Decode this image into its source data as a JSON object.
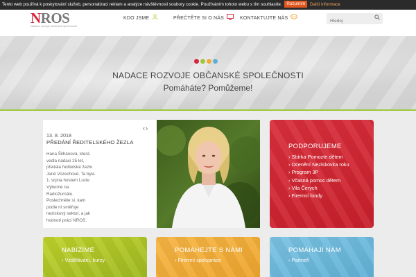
{
  "cookie_bar": {
    "text": "Tento web používá k poskytování služeb, personalizaci reklam a analýze návštěvnosti soubory cookie. Používáním tohoto webu s tím souhlasíte.",
    "accept_label": "Rozumím",
    "more_label": "Další informace"
  },
  "header": {
    "logo": {
      "text": "NROS",
      "subtitle": "Nadace rozvoje občanské společnosti"
    },
    "nav": [
      {
        "label": "KDO JSME",
        "icon": "person-icon"
      },
      {
        "label": "PŘEČTĚTE SI O NÁS",
        "icon": "screen-icon"
      },
      {
        "label": "KONTAKTUJTE NÁS",
        "icon": "chat-icon"
      }
    ],
    "search": {
      "placeholder": "Hledej"
    }
  },
  "hero": {
    "title": "NADACE ROZVOJE OBČANSKÉ SPOLEČNOSTI",
    "tagline": "Pomáháte? Pomůžeme!",
    "dot_colors": [
      "#d7263d",
      "#9ec83a",
      "#f2a93b",
      "#5eb0d6"
    ]
  },
  "news": {
    "date": "13. 8. 2018",
    "headline": "PŘEDÁNÍ ŘEDITELSKÉHO ŽEZLA",
    "body": "Hana Šilhánová, která vedla nadaci 25 let, předala ředitelské žezlo Janě Vozechové. Ta byla 1. srpna hostem Lucie Výborné na Radiožurnálu. Poslechněte si, kam podle ní směřuje neziskový sektor, a jak hodnotí práci NROS.",
    "prev": "‹",
    "next": "›"
  },
  "tiles": {
    "podporujeme": {
      "title": "PODPORUJEME",
      "items": [
        "› Sbírka Pomozte dětem",
        "› Ocenění Neziskovka roku",
        "› Program 3P",
        "› Včasná pomoc dětem",
        "› Vila Čerych",
        "› Firemní fondy"
      ]
    },
    "nabizime": {
      "title": "NABÍZÍME",
      "items": [
        "› Vzdělávání, kurzy"
      ]
    },
    "pomahejte": {
      "title": "POMÁHEJTE S NÁMI",
      "items": [
        "› Firemní spolupráce"
      ]
    },
    "pomahaji": {
      "title": "POMÁHAJÍ NÁM",
      "items": [
        "› Partneři"
      ]
    }
  },
  "colors": {
    "accent_green": "#9ec83a",
    "red": "#d92f3c",
    "lime": "#bfd22c",
    "orange": "#f6b545",
    "blue": "#7bc2e2",
    "cookie_button": "#e2561f"
  }
}
